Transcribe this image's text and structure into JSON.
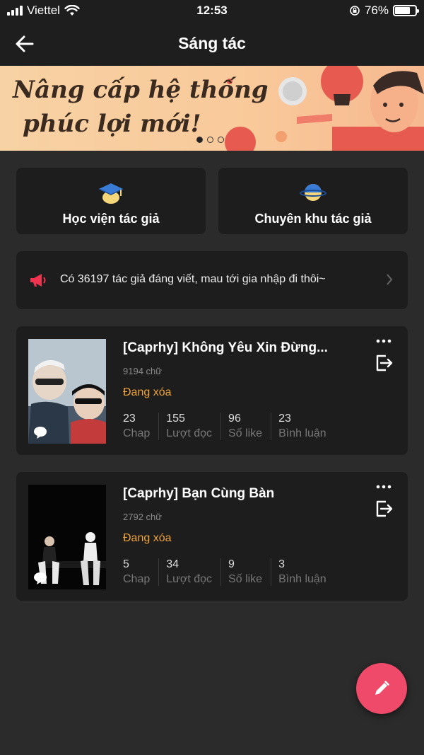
{
  "status_bar": {
    "carrier": "Viettel",
    "time": "12:53",
    "battery": "76%",
    "battery_level": 0.76
  },
  "navbar": {
    "title": "Sáng tác",
    "back_icon": "arrow-left-icon"
  },
  "banner": {
    "line1": "Nâng cấp hệ thống",
    "line2": "phúc lợi mới!",
    "active_index": 0,
    "total": 3
  },
  "features": [
    {
      "label": "Học viện tác giả",
      "icon": "graduation-cap-icon"
    },
    {
      "label": "Chuyên khu tác giả",
      "icon": "planet-icon"
    }
  ],
  "notice": {
    "text": "Có 36197 tác giả đáng viết, mau tới gia nhập đi thôi~",
    "icon": "megaphone-icon"
  },
  "stories": [
    {
      "title": "[Caprhy] Không Yêu Xin Đừng...",
      "words": "9194 chữ",
      "status": "Đang xóa",
      "stats": [
        {
          "value": "23",
          "label": "Chap"
        },
        {
          "value": "155",
          "label": "Lượt đọc"
        },
        {
          "value": "96",
          "label": "Số like"
        },
        {
          "value": "23",
          "label": "Bình luận"
        }
      ]
    },
    {
      "title": "[Caprhy] Bạn Cùng Bàn",
      "words": "2792 chữ",
      "status": "Đang xóa",
      "stats": [
        {
          "value": "5",
          "label": "Chap"
        },
        {
          "value": "34",
          "label": "Lượt đọc"
        },
        {
          "value": "9",
          "label": "Số like"
        },
        {
          "value": "3",
          "label": "Bình luận"
        }
      ]
    }
  ],
  "colors": {
    "background": "#2b2b2b",
    "card": "#1d1d1d",
    "status_orange": "#f0a23b",
    "fab": "#ef4a6a"
  },
  "fab_icon": "pencil-icon"
}
